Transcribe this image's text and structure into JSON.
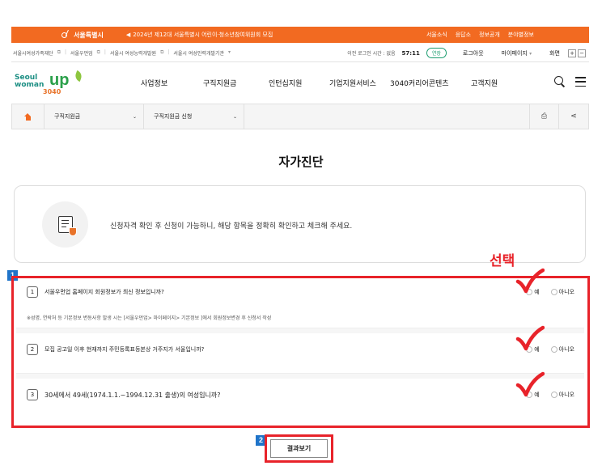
{
  "topbar": {
    "seal_text": "서울특별시",
    "notice": "2024년 제12대 서울특별시 어린이·청소년참여위원회 모집",
    "links": [
      "서울소식",
      "응답소",
      "정보공개",
      "분야별정보"
    ]
  },
  "utilbar": {
    "sites": [
      "서울시여성가족재단",
      "서울우먼업",
      "서울시 여성능력개발원",
      "서울시 여성인력개발기관"
    ],
    "session_label": "이전 로그인 시간 : 없음",
    "timer": "57:11",
    "extend": "연장",
    "logout": "로그아웃",
    "mypage": "마이페이지",
    "zoom_label": "화면",
    "zoom_in": "+",
    "zoom_out": "−"
  },
  "header": {
    "logo": {
      "seoul": "Seoul",
      "woman": "woman",
      "up": "up",
      "num": "3040"
    },
    "nav": [
      "사업정보",
      "구직지원금",
      "인턴십지원",
      "기업지원서비스",
      "3040커리어콘텐츠",
      "고객지원"
    ]
  },
  "breadcrumb": {
    "level1": "구직지원금",
    "level2": "구직지원금 신청"
  },
  "page": {
    "title": "자가진단",
    "info_message": "신청자격 확인 후 신청이 가능하니, 해당 항목을 정확히 확인하고 체크해 주세요."
  },
  "annotations": {
    "select_label": "선택",
    "badge1": "1",
    "badge2": "2",
    "accent_color": "#e8232a",
    "badge_color": "#1f74c9"
  },
  "questions": [
    {
      "num": "1",
      "text": "서울우먼업 홈페이지 회원정보가 최신 정보입니까?",
      "yes": "예",
      "no": "아니오",
      "note": "※성명, 연락처 등 기본정보 변동사항 발생 시는 [서울우먼업> 마이페이지> 기본정보 ]에서 회원정보변경 후 신청서 작성"
    },
    {
      "num": "2",
      "text": "모집 공고일 이후 현재까지 주민등록표등본상 거주지가 서울입니까?",
      "yes": "예",
      "no": "아니오"
    },
    {
      "num": "3",
      "text": "30세에서 49세(1974.1.1.~1994.12.31 출생)의 여성입니까?",
      "yes": "예",
      "no": "아니오"
    }
  ],
  "result_button": "결과보기"
}
